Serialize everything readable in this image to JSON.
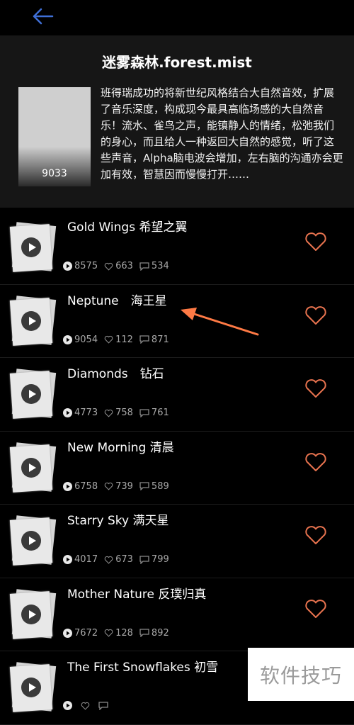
{
  "nav": {
    "back_icon": "arrow-left-icon"
  },
  "album": {
    "title": "迷雾森林.forest.mist",
    "cover_count": "9033",
    "description": "班得瑞成功的将新世纪风格结合大自然音效，扩展了音乐深度，构成现今最具高临场感的大自然音乐！流水、雀鸟之声，能镇静人的情绪，松弛我们的身心，而且给人一种返回大自然的感觉，听了这些声音，Alpha脑电波会增加，左右脑的沟通亦会更加有效，智慧因而慢慢打开……"
  },
  "tracks": [
    {
      "title": "Gold Wings 希望之翼",
      "plays": "8575",
      "likes": "663",
      "comments": "534"
    },
    {
      "title": "Neptune　海王星",
      "plays": "9054",
      "likes": "112",
      "comments": "871"
    },
    {
      "title": "Diamonds　钻石",
      "plays": "4773",
      "likes": "758",
      "comments": "761"
    },
    {
      "title": "New Morning 清晨",
      "plays": "6758",
      "likes": "739",
      "comments": "589"
    },
    {
      "title": "Starry Sky 满天星",
      "plays": "4017",
      "likes": "673",
      "comments": "799"
    },
    {
      "title": "Mother Nature 反璞归真",
      "plays": "7672",
      "likes": "128",
      "comments": "892"
    },
    {
      "title": "The First Snowflakes 初雪",
      "plays": "",
      "likes": "",
      "comments": ""
    }
  ],
  "watermark": "软件技巧",
  "colors": {
    "accent": "#3f6fd6",
    "heart": "#e8734f",
    "arrow": "#ff7a45"
  }
}
